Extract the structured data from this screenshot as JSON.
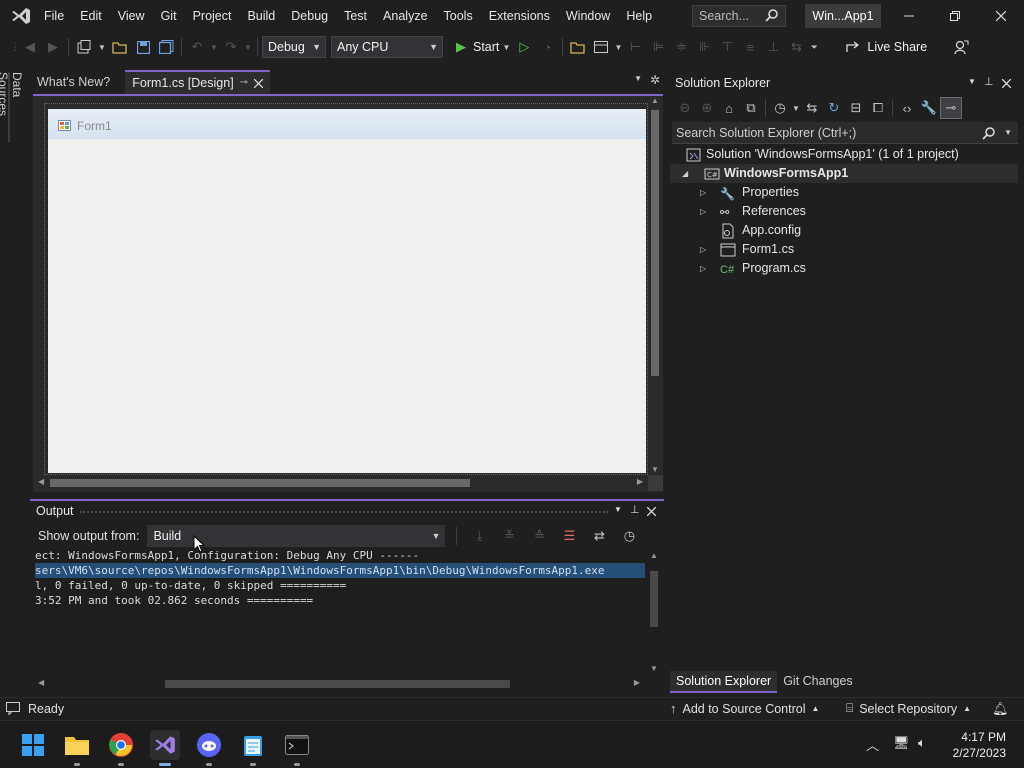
{
  "menu": [
    "File",
    "Edit",
    "View",
    "Git",
    "Project",
    "Build",
    "Debug",
    "Test",
    "Analyze",
    "Tools",
    "Extensions",
    "Window",
    "Help"
  ],
  "search": {
    "placeholder": "Search..."
  },
  "solution_title": "Win...App1",
  "toolbar": {
    "configuration": "Debug",
    "platform": "Any CPU",
    "start_label": "Start",
    "live_share_label": "Live Share"
  },
  "left_strip": {
    "data_sources": "Data Sources"
  },
  "doc_tabs": {
    "whats_new": "What's New?",
    "form_design": "Form1.cs [Design]"
  },
  "designer": {
    "form_title": "Form1"
  },
  "output": {
    "title": "Output",
    "show_from_label": "Show output from:",
    "source": "Build",
    "lines": [
      "ect: WindowsFormsApp1, Configuration: Debug Any CPU ------",
      "sers\\VM6\\source\\repos\\WindowsFormsApp1\\WindowsFormsApp1\\bin\\Debug\\WindowsFormsApp1.exe",
      "l, 0 failed, 0 up-to-date, 0 skipped ==========",
      "3:52 PM and took 02.862 seconds =========="
    ]
  },
  "solution_explorer": {
    "title": "Solution Explorer",
    "search_placeholder": "Search Solution Explorer (Ctrl+;)",
    "solution": "Solution 'WindowsFormsApp1' (1 of 1 project)",
    "project": "WindowsFormsApp1",
    "items": [
      "Properties",
      "References",
      "App.config",
      "Form1.cs",
      "Program.cs"
    ],
    "tabs": [
      "Solution Explorer",
      "Git Changes"
    ]
  },
  "statusbar": {
    "status": "Ready",
    "source_control": "Add to Source Control",
    "repository": "Select Repository"
  },
  "taskbar": {
    "time": "4:17 PM",
    "date": "2/27/2023"
  },
  "colors": {
    "accent": "#8065c9",
    "selection": "#264f78",
    "form_bg": "#f0f0f0"
  }
}
